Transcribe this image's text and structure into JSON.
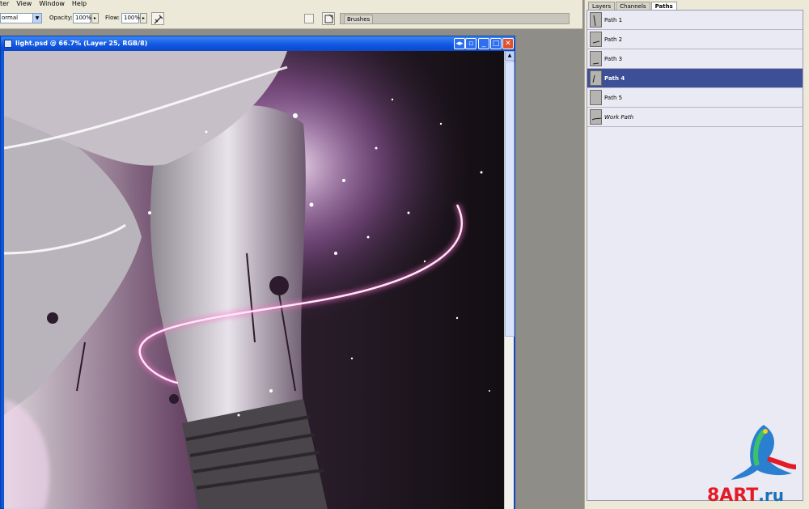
{
  "menu": {
    "items": [
      "ter",
      "View",
      "Window",
      "Help"
    ]
  },
  "options": {
    "mode_value": "ormal",
    "opacity_label": "Opacity:",
    "opacity_value": "100%",
    "flow_label": "Flow:",
    "flow_value": "100%",
    "brushes_tab": "Brushes"
  },
  "document": {
    "title": "light.psd @ 66.7% (Layer 25, RGB/8)",
    "buttons": [
      "◂▸",
      "▫",
      "_",
      "□",
      "✕"
    ]
  },
  "panel": {
    "tabs": [
      "Layers",
      "Channels",
      "Paths"
    ],
    "active_tab": "Paths",
    "paths": [
      {
        "label": "Path 1",
        "selected": false,
        "italic": false
      },
      {
        "label": "Path 2",
        "selected": false,
        "italic": false
      },
      {
        "label": "Path 3",
        "selected": false,
        "italic": false
      },
      {
        "label": "Path 4",
        "selected": true,
        "italic": false
      },
      {
        "label": "Path 5",
        "selected": false,
        "italic": false
      },
      {
        "label": "Work Path",
        "selected": false,
        "italic": true
      }
    ]
  },
  "watermark": {
    "text_main": "8ART",
    "text_suffix": ".ru"
  },
  "colors": {
    "selection": "#3c4f97",
    "title_bar": "#1055e1",
    "neon": "#ff6fd0",
    "watermark_red": "#e31b25",
    "watermark_blue": "#1b71b7"
  }
}
